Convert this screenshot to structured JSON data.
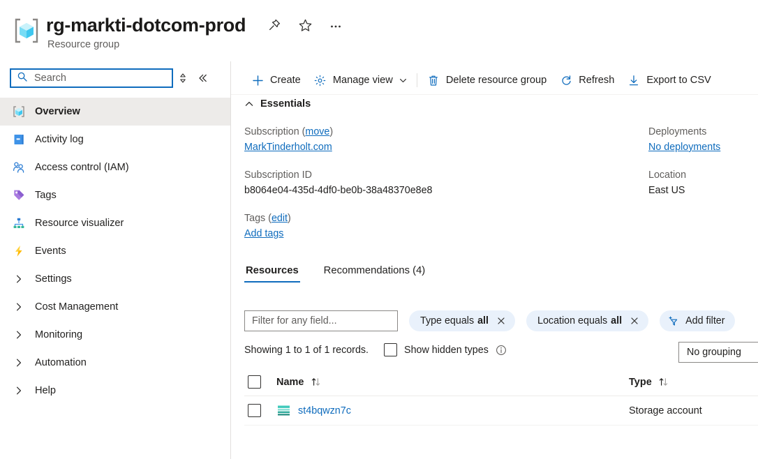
{
  "header": {
    "title": "rg-markti-dotcom-prod",
    "subtitle": "Resource group",
    "icon": "resource-group-cube-icon",
    "actions": [
      {
        "name": "pin-icon",
        "label": "Pin"
      },
      {
        "name": "favorite-star-icon",
        "label": "Favorite"
      },
      {
        "name": "more-ellipsis-icon",
        "label": "More"
      }
    ]
  },
  "sidebar": {
    "search": {
      "placeholder": "Search",
      "value": "",
      "icon": "search-icon"
    },
    "sort_toggle_icon": "sort-updown-icon",
    "collapse_icon": "collapse-double-chevron-left-icon",
    "items": [
      {
        "label": "Overview",
        "icon": "resource-group-cube-icon",
        "selected": true
      },
      {
        "label": "Activity log",
        "icon": "activity-log-book-icon",
        "selected": false
      },
      {
        "label": "Access control (IAM)",
        "icon": "access-control-people-icon",
        "selected": false
      },
      {
        "label": "Tags",
        "icon": "tag-icon",
        "selected": false
      },
      {
        "label": "Resource visualizer",
        "icon": "resource-visualizer-icon",
        "selected": false
      },
      {
        "label": "Events",
        "icon": "events-lightning-icon",
        "selected": false
      }
    ],
    "groups": [
      {
        "label": "Settings",
        "icon": "chevron-right-icon"
      },
      {
        "label": "Cost Management",
        "icon": "chevron-right-icon"
      },
      {
        "label": "Monitoring",
        "icon": "chevron-right-icon"
      },
      {
        "label": "Automation",
        "icon": "chevron-right-icon"
      },
      {
        "label": "Help",
        "icon": "chevron-right-icon"
      }
    ]
  },
  "toolbar": {
    "create_label": "Create",
    "manage_view_label": "Manage view",
    "delete_label": "Delete resource group",
    "refresh_label": "Refresh",
    "export_label": "Export to CSV"
  },
  "essentials": {
    "header": "Essentials",
    "subscription_label": "Subscription (",
    "subscription_move_link": "move",
    "subscription_label_close": ")",
    "subscription_value": "MarkTinderholt.com",
    "subscription_id_label": "Subscription ID",
    "subscription_id_value": "b8064e04-435d-4df0-be0b-38a48370e8e8",
    "tags_label": "Tags (",
    "tags_edit_link": "edit",
    "tags_label_close": ")",
    "tags_value": "Add tags",
    "deployments_label": "Deployments",
    "deployments_value": "No deployments",
    "location_label": "Location",
    "location_value": "East US"
  },
  "tabs": [
    {
      "label": "Resources",
      "active": true
    },
    {
      "label": "Recommendations (4)",
      "active": false
    }
  ],
  "filters": {
    "input_placeholder": "Filter for any field...",
    "input_value": "",
    "pills": [
      {
        "prefix": "Type equals",
        "value": "all",
        "clear_icon": "close-x-icon"
      },
      {
        "prefix": "Location equals",
        "value": "all",
        "clear_icon": "close-x-icon"
      }
    ],
    "add_filter_label": "Add filter",
    "add_filter_icon": "add-filter-funnel-icon"
  },
  "status": {
    "records_text": "Showing 1 to 1 of 1 records.",
    "show_hidden_label": "Show hidden types",
    "show_hidden_checked": false,
    "info_icon": "info-circle-icon",
    "grouping_value": "No grouping"
  },
  "table": {
    "columns": [
      {
        "label": "Name",
        "sort_icon": "sort-arrows-icon"
      },
      {
        "label": "Type",
        "sort_icon": "sort-arrows-icon"
      }
    ],
    "rows": [
      {
        "name": "st4bqwzn7c",
        "type": "Storage account",
        "icon": "storage-account-icon",
        "checked": false
      }
    ]
  },
  "colors": {
    "accent_blue": "#0f6cbd",
    "link_blue": "#0f6cbd",
    "pill_bg": "#e9f1fb",
    "selected_nav_bg": "#edebe9",
    "cube_cyan": "#5bd2f0",
    "storage_teal": "#37c2b1",
    "text_primary": "#201f1e",
    "text_secondary": "#605e5c"
  }
}
